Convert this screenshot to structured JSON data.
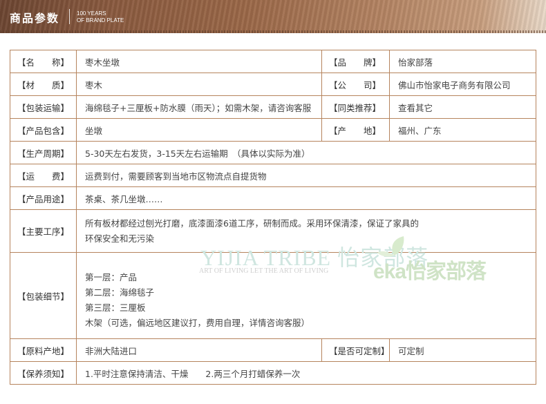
{
  "banner": {
    "title": "商品参数",
    "sub_line1": "100 YEARS",
    "sub_line2": "OF BRAND PLATE"
  },
  "rows": {
    "name": {
      "label": "【名　　称】",
      "value": "枣木坐墩"
    },
    "brand": {
      "label": "【品　　牌】",
      "value": "怡家部落"
    },
    "material": {
      "label": "【材　　质】",
      "value": "枣木"
    },
    "company": {
      "label": "【公　　司】",
      "value": "佛山市怡家电子商务有限公司"
    },
    "shipping_pack": {
      "label": "【包装运输】",
      "value": "海绵毯子+三厘板+防水膜（雨天）；如需木架，请咨询客服"
    },
    "similar": {
      "label": "【同类推荐】",
      "value": "查看其它"
    },
    "contents": {
      "label": "【产品包含】",
      "value": "坐墩"
    },
    "origin_place": {
      "label": "【产　　地】",
      "value": "福州、广东"
    },
    "cycle": {
      "label": "【生产周期】",
      "value": "5-30天左右发货，3-15天左右运输期　（具体以实际为准）"
    },
    "freight": {
      "label": "【运　　费】",
      "value": "运费到付，需要顾客到当地市区物流点自提货物"
    },
    "usage": {
      "label": "【产品用途】",
      "value": "茶桌、茶几坐墩……"
    },
    "process": {
      "label": "【主要工序】",
      "line1": "所有板材都经过刨光打磨，底漆面漆6道工序，研制而成。采用环保清漆，保证了家具的",
      "line2": "环保安全和无污染"
    },
    "packing_detail": {
      "label": "【包装细节】",
      "lines": [
        "第一层：产品",
        "第二层：海绵毯子",
        "第三层：三厘板",
        "木架（可选，偏远地区建议打，费用自理，详情咨询客服）"
      ]
    },
    "material_origin": {
      "label": "【原料产地】",
      "value": "非洲大陆进口"
    },
    "customizable": {
      "label": "【是否可定制】",
      "value": "可定制"
    },
    "care": {
      "label": "【保养须知】",
      "value": "1.平时注意保持清洁、干燥　　2.两三个月打蜡保养一次"
    }
  },
  "watermark": {
    "text": "YIJIA TRIBE 怡家部落",
    "sub": "ART OF LIVING LET THE ART OF LIVING",
    "logo_text": "eka怡家部落"
  },
  "colors": {
    "border": "#b5835c",
    "accent_red": "#c12a2a",
    "link_blue": "#3a55a4"
  }
}
